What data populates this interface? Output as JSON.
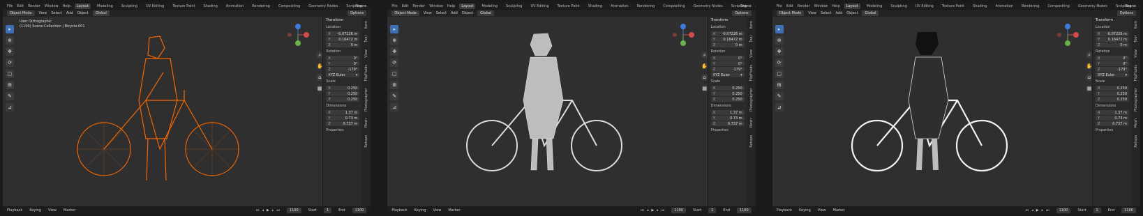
{
  "top_menu": [
    "File",
    "Edit",
    "Render",
    "Window",
    "Help"
  ],
  "workspaces": [
    {
      "label": "Layout",
      "active": true
    },
    {
      "label": "Modeling",
      "active": false
    },
    {
      "label": "Sculpting",
      "active": false
    },
    {
      "label": "UV Editing",
      "active": false
    },
    {
      "label": "Texture Paint",
      "active": false
    },
    {
      "label": "Shading",
      "active": false
    },
    {
      "label": "Animation",
      "active": false
    },
    {
      "label": "Rendering",
      "active": false
    },
    {
      "label": "Compositing",
      "active": false
    },
    {
      "label": "Geometry Nodes",
      "active": false
    },
    {
      "label": "Scripting",
      "active": false
    },
    {
      "label": "+",
      "active": false
    }
  ],
  "scene_label": "Scene",
  "header_bar": {
    "mode": "Object Mode",
    "view": "View",
    "select": "Select",
    "add": "Add",
    "object": "Object",
    "orientation": "Global",
    "options": "Options"
  },
  "viewport_info": {
    "line1": "User Orthographic",
    "line2": "(1100) Scene Collection | Bicycle.001"
  },
  "npanel": {
    "title": "Transform",
    "location_label": "Location",
    "location": [
      {
        "axis": "X",
        "value": "-0.07226 m"
      },
      {
        "axis": "Y",
        "value": "0.16472 m"
      },
      {
        "axis": "Z",
        "value": "0 m"
      }
    ],
    "rotation_label": "Rotation",
    "rotation": [
      {
        "axis": "X",
        "value": "0°"
      },
      {
        "axis": "Y",
        "value": "0°"
      },
      {
        "axis": "Z",
        "value": "-179°"
      }
    ],
    "rotation_mode": "XYZ Euler",
    "scale_label": "Scale",
    "scale": [
      {
        "axis": "X",
        "value": "0.250"
      },
      {
        "axis": "Y",
        "value": "0.250"
      },
      {
        "axis": "Z",
        "value": "0.250"
      }
    ],
    "dimensions_label": "Dimensions",
    "dimensions": [
      {
        "axis": "X",
        "value": "1.37 m"
      },
      {
        "axis": "Y",
        "value": "0.73 m"
      },
      {
        "axis": "Z",
        "value": "0.737 m"
      }
    ],
    "properties": "Properties"
  },
  "side_tabs": [
    "Item",
    "Tool",
    "View",
    "FlipFluids",
    "Photographer",
    "Mesh",
    "Retopo"
  ],
  "footer": {
    "playback": "Playback",
    "keying": "Keying",
    "view": "View",
    "marker": "Marker",
    "current_frame": "1100",
    "start_label": "Start",
    "start": "1",
    "end_label": "End",
    "end": "1100"
  },
  "panels": [
    {
      "style": "wireframe",
      "accent": "#ff6a00"
    },
    {
      "style": "solid",
      "accent": "#d9d9d9"
    },
    {
      "style": "textured",
      "accent": "#f0f0f0"
    }
  ]
}
